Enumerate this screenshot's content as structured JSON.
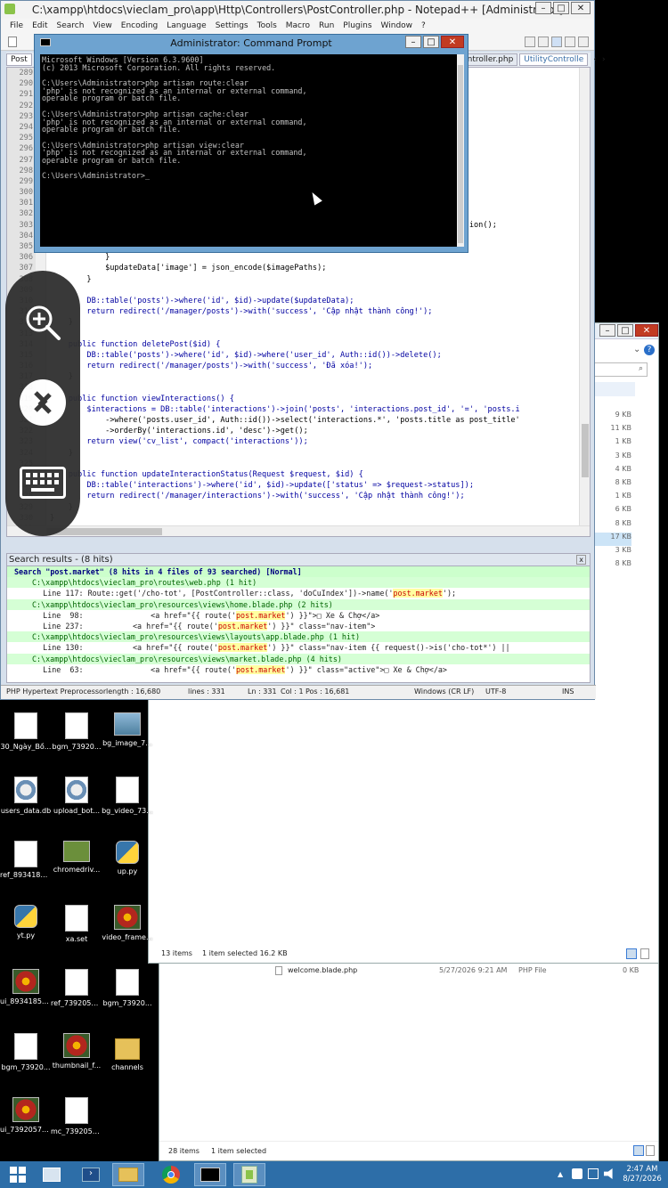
{
  "explorer_back": {
    "files": [
      {
        "name": "welcome.blade.php",
        "date": "5/27/2026 9:21 AM",
        "type": "PHP File",
        "size": "0 KB"
      }
    ],
    "status_items": "28 items",
    "status_selected": "1 item selected"
  },
  "explorer_mid": {
    "sizes": [
      "9 KB",
      "11 KB",
      "1 KB",
      "3 KB",
      "4 KB",
      "8 KB",
      "1 KB",
      "6 KB",
      "8 KB",
      "17 KB",
      "3 KB",
      "8 KB"
    ],
    "status_items": "13 items",
    "status_selected": "1 item selected  16.2 KB"
  },
  "npp": {
    "title": "C:\\xampp\\htdocs\\vieclam_pro\\app\\Http\\Controllers\\PostController.php - Notepad++ [Administrator]",
    "menu": [
      "File",
      "Edit",
      "Search",
      "View",
      "Encoding",
      "Language",
      "Settings",
      "Tools",
      "Macro",
      "Run",
      "Plugins",
      "Window",
      "?"
    ],
    "tabs": [
      "Post",
      "Controller.php",
      "UtilityControlle"
    ],
    "line_numbers": [
      "289",
      "290",
      "291",
      "292",
      "293",
      "294",
      "295",
      "296",
      "297",
      "298",
      "299",
      "300",
      "301",
      "302",
      "303",
      "304",
      "305",
      "306",
      "307",
      "308",
      "309",
      "310",
      "311",
      "312",
      "313",
      "314",
      "315",
      "316",
      "317",
      "318",
      "319",
      "320",
      "321",
      "322",
      "323",
      "324",
      "325",
      "326",
      "327",
      "328",
      "329",
      "330",
      "331"
    ],
    "code": [
      "",
      "",
      "",
      "",
      "",
      "",
      "",
      "",
      "",
      "",
      "",
      "",
      "",
      "",
      "                                                                                  nalExtension();",
      "",
      "",
      "            }",
      "            $updateData['image'] = json_encode($imagePaths);",
      "        }",
      "",
      "        DB::table('posts')->where('id', $id)->update($updateData);",
      "        return redirect('/manager/posts')->with('success', 'Cập nhật thành công!');",
      "    }",
      "",
      "    public function deletePost($id) {",
      "        DB::table('posts')->where('id', $id)->where('user_id', Auth::id())->delete();",
      "        return redirect('/manager/posts')->with('success', 'Đã xóa!');",
      "    }",
      "",
      "    public function viewInteractions() {",
      "        $interactions = DB::table('interactions')->join('posts', 'interactions.post_id', '=', 'posts.i",
      "            ->where('posts.user_id', Auth::id())->select('interactions.*', 'posts.title as post_title'",
      "            ->orderBy('interactions.id', 'desc')->get();",
      "        return view('cv_list', compact('interactions'));",
      "    }",
      "",
      "    public function updateInteractionStatus(Request $request, $id) {",
      "        DB::table('interactions')->where('id', $id)->update(['status' => $request->status]);",
      "        return redirect('/manager/interactions')->with('success', 'Cập nhật thành công!');",
      "    }",
      "}",
      ""
    ],
    "results_title": "Search results - (8 hits)",
    "results_close": "x",
    "results": [
      {
        "kind": "head",
        "text": "Search \"post.market\" (8 hits in 4 files of 93 searched) [Normal]"
      },
      {
        "kind": "file",
        "text": "C:\\xampp\\htdocs\\vieclam_pro\\routes\\web.php (1 hit)"
      },
      {
        "kind": "hit",
        "pre": "    Line 117: Route::get('/cho-tot', [PostController::class, 'doCuIndex'])->name('",
        "hit": "post.market",
        "post": "');"
      },
      {
        "kind": "file",
        "text": "C:\\xampp\\htdocs\\vieclam_pro\\resources\\views\\home.blade.php (2 hits)"
      },
      {
        "kind": "hit",
        "pre": "    Line  98:               <a href=\"{{ route('",
        "hit": "post.market",
        "post": "') }}\">□ Xe & Chợ</a>"
      },
      {
        "kind": "hit",
        "pre": "    Line 237:           <a href=\"{{ route('",
        "hit": "post.market",
        "post": "') }}\" class=\"nav-item\">"
      },
      {
        "kind": "file",
        "text": "C:\\xampp\\htdocs\\vieclam_pro\\resources\\views\\layouts\\app.blade.php (1 hit)"
      },
      {
        "kind": "hit",
        "pre": "    Line 130:           <a href=\"{{ route('",
        "hit": "post.market",
        "post": "') }}\" class=\"nav-item {{ request()->is('cho-tot*') ||"
      },
      {
        "kind": "file",
        "text": "C:\\xampp\\htdocs\\vieclam_pro\\resources\\views\\market.blade.php (4 hits)"
      },
      {
        "kind": "hit",
        "pre": "    Line  63:               <a href=\"{{ route('",
        "hit": "post.market",
        "post": "') }}\" class=\"active\">□ Xe & Chợ</a>"
      }
    ],
    "status": {
      "lang": "PHP Hypertext Preprocessor",
      "length": "length : 16,680",
      "lines": "lines : 331",
      "ln": "Ln : 331",
      "col": "Col : 1",
      "pos": "Pos : 16,681",
      "eol": "Windows (CR LF)",
      "enc": "UTF-8",
      "ins": "INS"
    }
  },
  "cmd": {
    "title": "Administrator: Command Prompt",
    "lines": [
      "Microsoft Windows [Version 6.3.9600]",
      "(c) 2013 Microsoft Corporation. All rights reserved.",
      "",
      "C:\\Users\\Administrator>php artisan route:clear",
      "'php' is not recognized as an internal or external command,",
      "operable program or batch file.",
      "",
      "C:\\Users\\Administrator>php artisan cache:clear",
      "'php' is not recognized as an internal or external command,",
      "operable program or batch file.",
      "",
      "C:\\Users\\Administrator>php artisan view:clear",
      "'php' is not recognized as an internal or external command,",
      "operable program or batch file.",
      "",
      "C:\\Users\\Administrator>_"
    ]
  },
  "desktop": {
    "icons": [
      {
        "label": "30_Ngày_Bồ...",
        "kind": "doc"
      },
      {
        "label": "bgm_73920...",
        "kind": "doc"
      },
      {
        "label": "bg_image_7...",
        "kind": "img"
      },
      {
        "label": "users_data.db",
        "kind": "gear"
      },
      {
        "label": "upload_bot...",
        "kind": "gear"
      },
      {
        "label": "bg_video_73...",
        "kind": "doc"
      },
      {
        "label": "ref_8934185...",
        "kind": "doc"
      },
      {
        "label": "chromedriv...",
        "kind": "app"
      },
      {
        "label": "up.py",
        "kind": "py"
      },
      {
        "label": "yt.py",
        "kind": "py"
      },
      {
        "label": "xa.set",
        "kind": "doc"
      },
      {
        "label": "video_frame...",
        "kind": "flower"
      },
      {
        "label": "ui_89341858...",
        "kind": "flower"
      },
      {
        "label": "ref_7392057...",
        "kind": "doc"
      },
      {
        "label": "bgm_73920...",
        "kind": "doc"
      },
      {
        "label": "bgm_73920...",
        "kind": "doc"
      },
      {
        "label": "thumbnail_f...",
        "kind": "flower"
      },
      {
        "label": "channels",
        "kind": "folder"
      },
      {
        "label": "ui_73920577...",
        "kind": "flower"
      },
      {
        "label": "mc_7392057...",
        "kind": "doc"
      }
    ]
  },
  "taskbar": {
    "time": "2:47 AM",
    "date": "8/27/2026"
  }
}
